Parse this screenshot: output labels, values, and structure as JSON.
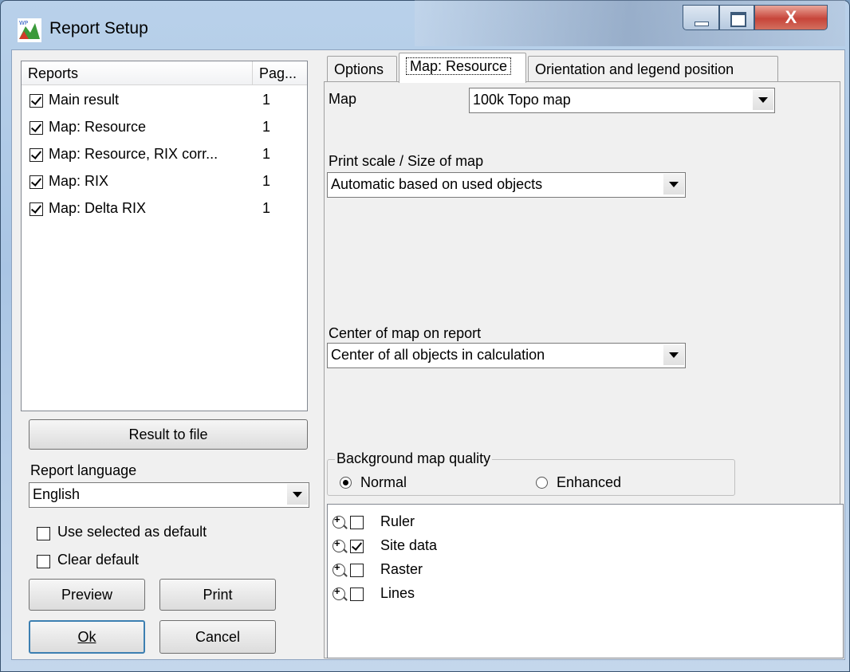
{
  "window": {
    "title": "Report Setup"
  },
  "reports": {
    "header_reports": "Reports",
    "header_pages": "Pag...",
    "items": [
      {
        "name": "Main result",
        "pages": "1",
        "checked": true
      },
      {
        "name": "Map: Resource",
        "pages": "1",
        "checked": true
      },
      {
        "name": "Map: Resource, RIX corr...",
        "pages": "1",
        "checked": true
      },
      {
        "name": "Map: RIX",
        "pages": "1",
        "checked": true
      },
      {
        "name": "Map: Delta RIX",
        "pages": "1",
        "checked": true
      }
    ]
  },
  "left": {
    "result_to_file": "Result to file",
    "language_label": "Report language",
    "language_value": "English",
    "use_selected_default": "Use selected as default",
    "clear_default": "Clear default",
    "preview": "Preview",
    "print": "Print",
    "ok": "Ok",
    "cancel": "Cancel"
  },
  "tabs": {
    "options": "Options",
    "map_resource": "Map: Resource",
    "orientation": "Orientation and legend position"
  },
  "panel": {
    "map_label": "Map",
    "map_value": "100k Topo map",
    "scale_label": "Print scale / Size of map",
    "scale_value": "Automatic based on used objects",
    "center_label": "Center of map on report",
    "center_value": "Center of all objects in calculation",
    "quality_label": "Background map quality",
    "quality_normal": "Normal",
    "quality_enhanced": "Enhanced",
    "layers": [
      {
        "name": "Ruler",
        "checked": false
      },
      {
        "name": "Site data",
        "checked": true
      },
      {
        "name": "Raster",
        "checked": false
      },
      {
        "name": "Lines",
        "checked": false
      }
    ]
  }
}
